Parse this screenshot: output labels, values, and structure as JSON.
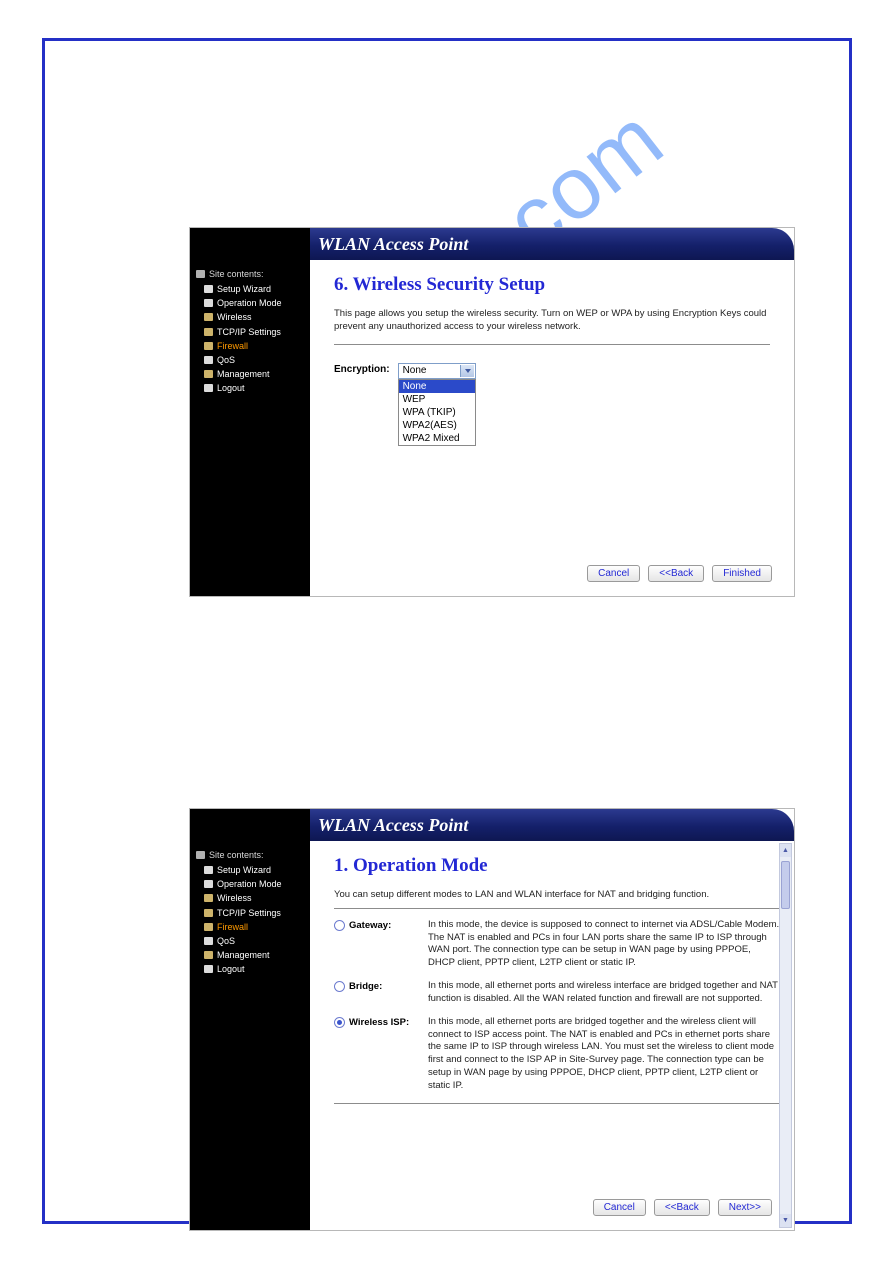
{
  "app_title": "WLAN Access Point",
  "watermark": "ualshive.com",
  "sidebar": {
    "header": "Site contents:",
    "items": [
      {
        "label": "Setup Wizard",
        "icon": "page",
        "active": false
      },
      {
        "label": "Operation Mode",
        "icon": "page",
        "active": false
      },
      {
        "label": "Wireless",
        "icon": "folder",
        "active": false
      },
      {
        "label": "TCP/IP Settings",
        "icon": "folder",
        "active": false
      },
      {
        "label": "Firewall",
        "icon": "folder",
        "active": true
      },
      {
        "label": "QoS",
        "icon": "page",
        "active": false
      },
      {
        "label": "Management",
        "icon": "folder",
        "active": false
      },
      {
        "label": "Logout",
        "icon": "page",
        "active": false
      }
    ]
  },
  "panel1": {
    "title": "6. Wireless Security Setup",
    "description": "This page allows you setup the wireless security. Turn on WEP or WPA by using Encryption Keys could prevent any unauthorized access to your wireless network.",
    "encryption_label": "Encryption:",
    "encryption_selected": "None",
    "encryption_options": [
      "None",
      "WEP",
      "WPA (TKIP)",
      "WPA2(AES)",
      "WPA2 Mixed"
    ],
    "buttons": {
      "cancel": "Cancel",
      "back": "<<Back",
      "finished": "Finished"
    }
  },
  "panel2": {
    "title": "1. Operation Mode",
    "description": "You can setup different modes to LAN and WLAN interface for NAT and bridging function.",
    "modes": [
      {
        "label": "Gateway:",
        "checked": false,
        "desc": "In this mode, the device is supposed to connect to internet via ADSL/Cable Modem. The NAT is enabled and PCs in four LAN ports share the same IP to ISP through WAN port. The connection type can be setup in WAN page by using PPPOE, DHCP client, PPTP client, L2TP client or static IP."
      },
      {
        "label": "Bridge:",
        "checked": false,
        "desc": "In this mode, all ethernet ports and wireless interface are bridged together and NAT function is disabled. All the WAN related function and firewall are not supported."
      },
      {
        "label": "Wireless ISP:",
        "checked": true,
        "desc": "In this mode, all ethernet ports are bridged together and the wireless client will connect to ISP access point. The NAT is enabled and PCs in ethernet ports share the same IP to ISP through wireless LAN. You must set the wireless to client mode first and connect to the ISP AP in Site-Survey page. The connection type can be setup in WAN page by using PPPOE, DHCP client, PPTP client, L2TP client or static IP."
      }
    ],
    "buttons": {
      "cancel": "Cancel",
      "back": "<<Back",
      "next": "Next>>"
    }
  }
}
